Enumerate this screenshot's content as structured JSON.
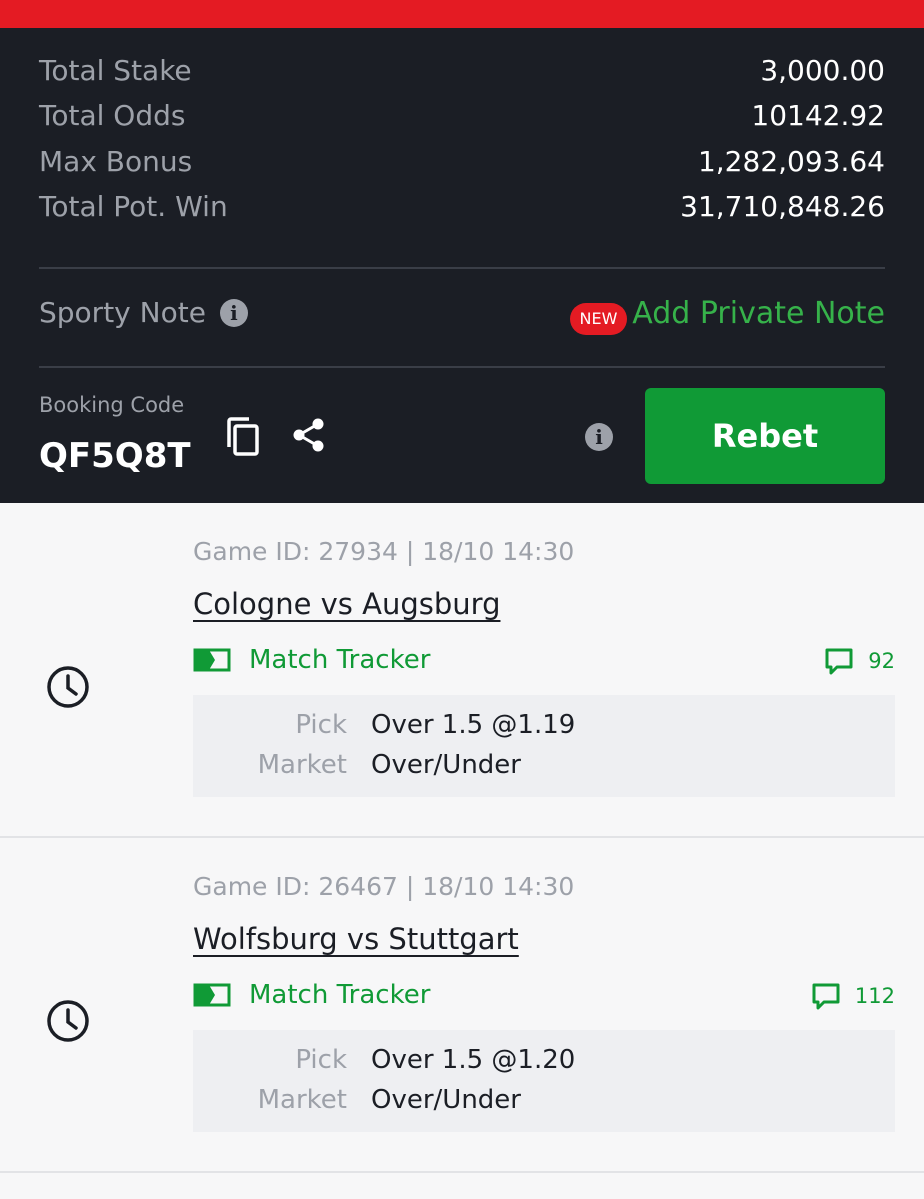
{
  "summary": {
    "rows": [
      {
        "label": "Total Stake",
        "value": "3,000.00"
      },
      {
        "label": "Total Odds",
        "value": "10142.92"
      },
      {
        "label": "Max Bonus",
        "value": "1,282,093.64"
      },
      {
        "label": "Total Pot. Win",
        "value": "31,710,848.26"
      }
    ],
    "note_label": "Sporty Note",
    "new_badge": "NEW",
    "add_note": "Add Private Note",
    "booking_label": "Booking Code",
    "booking_code": "QF5Q8T",
    "rebet": "Rebet"
  },
  "games": [
    {
      "meta": "Game ID: 27934 | 18/10 14:30",
      "teams": "Cologne vs Augsburg",
      "tracker": "Match Tracker",
      "comments": "92",
      "pick_label": "Pick",
      "pick": "Over 1.5 @1.19",
      "market_label": "Market",
      "market": "Over/Under"
    },
    {
      "meta": "Game ID: 26467 | 18/10 14:30",
      "teams": "Wolfsburg vs Stuttgart",
      "tracker": "Match Tracker",
      "comments": "112",
      "pick_label": "Pick",
      "pick": "Over 1.5 @1.20",
      "market_label": "Market",
      "market": "Over/Under"
    }
  ],
  "colors": {
    "brand_red": "#e41b23",
    "dark_bg": "#1b1e25",
    "green": "#109a36",
    "accent_green": "#36b24a"
  },
  "icons": [
    "info-icon",
    "copy-icon",
    "share-icon",
    "clock-icon",
    "match-tracker-icon",
    "comment-icon"
  ]
}
